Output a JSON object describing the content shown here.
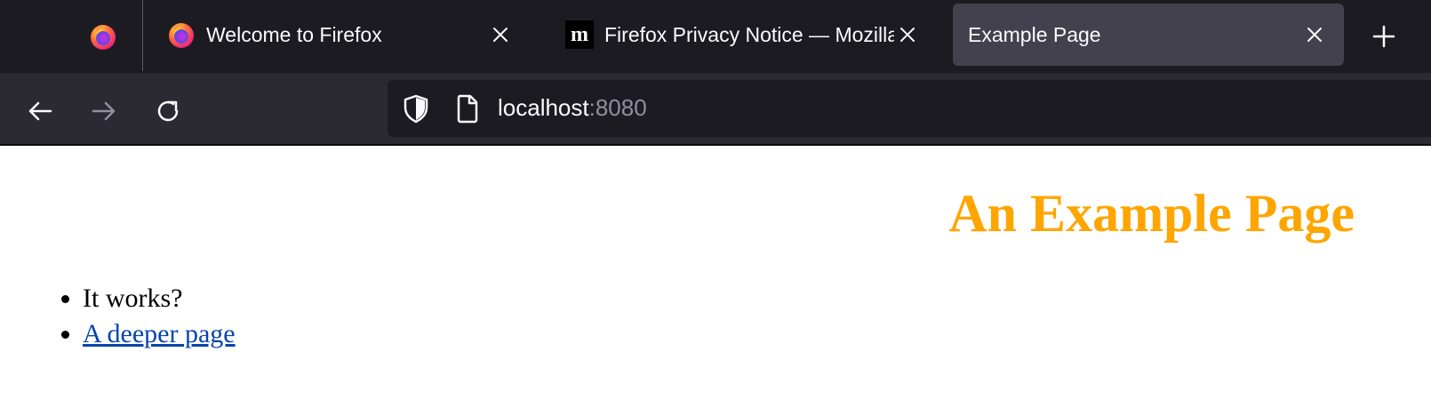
{
  "browser": {
    "tabs": [
      {
        "title": "Welcome to Firefox",
        "favicon": "firefox-icon",
        "active": false
      },
      {
        "title": "Firefox Privacy Notice — Mozilla",
        "favicon": "mozilla-m-icon",
        "active": false
      },
      {
        "title": "Example Page",
        "favicon": "none",
        "active": true
      }
    ],
    "pinned_tab": {
      "favicon": "firefox-icon"
    },
    "new_tab_icon": "plus-icon",
    "nav": {
      "back_icon": "arrow-left-icon",
      "forward_icon": "arrow-right-icon",
      "reload_icon": "reload-icon"
    },
    "urlbar": {
      "host": "localhost",
      "port": ":8080",
      "shield_icon": "shield-icon",
      "page_icon": "page-icon"
    },
    "colors": {
      "tabstrip_bg": "#1c1b22",
      "navbar_bg": "#2b2a33",
      "active_tab_bg": "#42414d",
      "text": "#fbfbfe"
    }
  },
  "page": {
    "heading": "An Example Page",
    "heading_color": "#ffa500",
    "list": [
      {
        "text": "It works?",
        "link": false
      },
      {
        "text": "A deeper page",
        "link": true
      }
    ],
    "link_color": "#0645ad"
  }
}
